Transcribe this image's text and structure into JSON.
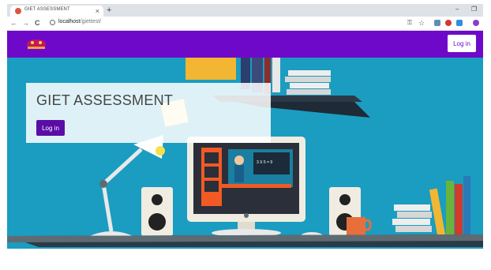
{
  "browser": {
    "tab_title": "GIET ASSESSMENT",
    "tab_close": "×",
    "new_tab": "+",
    "url_host": "localhost",
    "url_path": "/giettest/",
    "minimize": "–",
    "restore": "❐"
  },
  "navbar": {
    "login_label": "Log in",
    "brand_color": "#6f09c9"
  },
  "hero": {
    "title": "GIET ASSESSMENT",
    "login_label": "Log in",
    "board_text": "3 X 5 = 9"
  },
  "icons": {
    "back": "←",
    "forward": "→",
    "reload": "C",
    "key": "⚿",
    "star": "☆"
  }
}
